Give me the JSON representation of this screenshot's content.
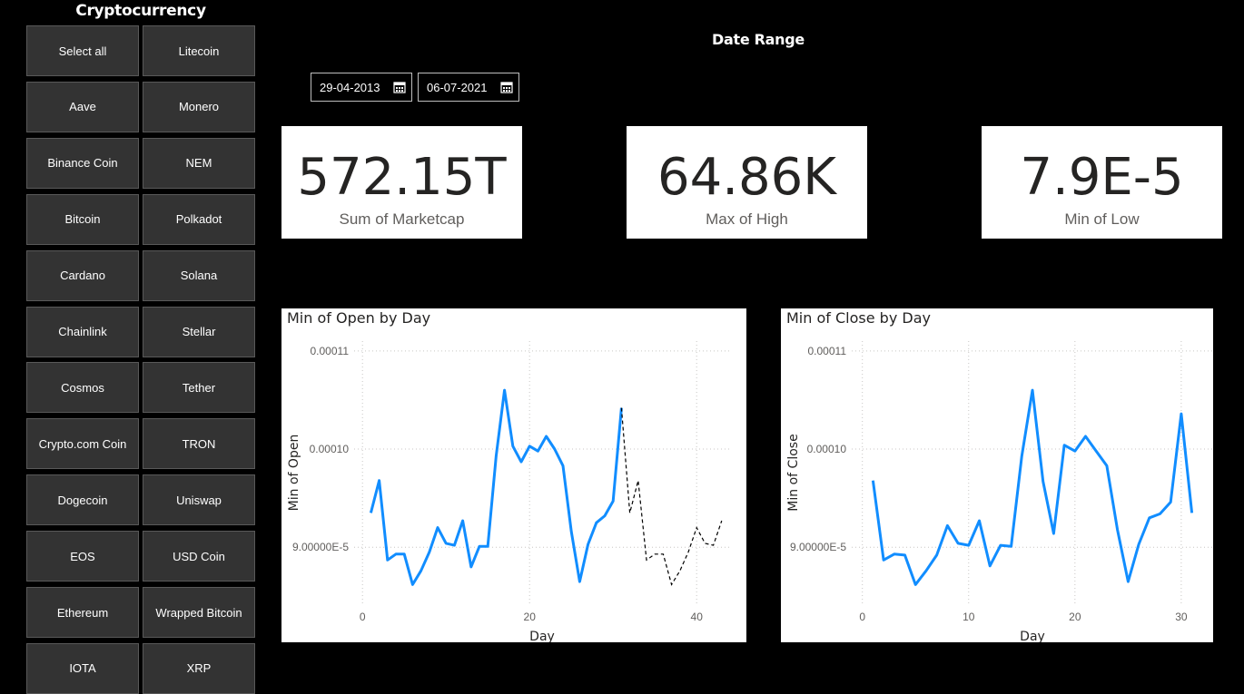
{
  "slicer": {
    "title": "Cryptocurrency",
    "items": [
      "Select all",
      "Litecoin",
      "Aave",
      "Monero",
      "Binance Coin",
      "NEM",
      "Bitcoin",
      "Polkadot",
      "Cardano",
      "Solana",
      "Chainlink",
      "Stellar",
      "Cosmos",
      "Tether",
      "Crypto.com Coin",
      "TRON",
      "Dogecoin",
      "Uniswap",
      "EOS",
      "USD Coin",
      "Ethereum",
      "Wrapped Bitcoin",
      "IOTA",
      "XRP"
    ]
  },
  "date_range": {
    "title": "Date Range",
    "start": "29-04-2013",
    "end": "06-07-2021",
    "icon": "calendar-icon"
  },
  "cards": [
    {
      "value": "572.15T",
      "label": "Sum of Marketcap"
    },
    {
      "value": "64.86K",
      "label": "Max of High"
    },
    {
      "value": "7.9E-5",
      "label": "Min of Low"
    }
  ],
  "colors": {
    "background": "#000000",
    "tile": "#333333",
    "line": "#118DFF",
    "forecast": "#000000"
  },
  "chart_data": [
    {
      "type": "line",
      "title": "Min of Open by Day",
      "xlabel": "Day",
      "ylabel": "Min of Open",
      "x_ticks": [
        0,
        20,
        40
      ],
      "y_ticks": [
        "9.00000E-5",
        "0.00010",
        "0.00011"
      ],
      "y_tick_values": [
        9e-05,
        0.0001,
        0.00011
      ],
      "xlim": [
        -1,
        44
      ],
      "ylim": [
        8.42e-05,
        0.000111
      ],
      "grid": true,
      "series": [
        {
          "style": "solid",
          "x": [
            1,
            2,
            3,
            4,
            5,
            6,
            7,
            8,
            9,
            10,
            11,
            12,
            13,
            14,
            15,
            16,
            17,
            18,
            19,
            20,
            21,
            22,
            23,
            24,
            25,
            26,
            27,
            28,
            29,
            30,
            31
          ],
          "y": [
            9.35e-05,
            9.68e-05,
            8.87e-05,
            8.93e-05,
            8.93e-05,
            8.62e-05,
            8.76e-05,
            8.95e-05,
            9.2e-05,
            9.04e-05,
            9.02e-05,
            9.27e-05,
            8.8e-05,
            9.01e-05,
            9.01e-05,
            9.93e-05,
            0.000106,
            0.0001003,
            9.87e-05,
            0.0001003,
            9.98e-05,
            0.0001013,
            0.0001,
            9.83e-05,
            9.16e-05,
            8.65e-05,
            9.03e-05,
            9.25e-05,
            9.32e-05,
            9.47e-05,
            0.0001042
          ]
        },
        {
          "style": "dashed",
          "x": [
            31,
            32,
            33,
            34,
            35,
            36,
            37,
            38,
            39,
            40,
            41,
            42,
            43
          ],
          "y": [
            0.0001042,
            9.35e-05,
            9.68e-05,
            8.87e-05,
            8.93e-05,
            8.93e-05,
            8.62e-05,
            8.76e-05,
            8.95e-05,
            9.2e-05,
            9.04e-05,
            9.02e-05,
            9.27e-05
          ]
        }
      ]
    },
    {
      "type": "line",
      "title": "Min of Close by Day",
      "xlabel": "Day",
      "ylabel": "Min of Close",
      "x_ticks": [
        0,
        10,
        20,
        30
      ],
      "y_ticks": [
        "9.00000E-5",
        "0.00010",
        "0.00011"
      ],
      "y_tick_values": [
        9e-05,
        0.0001,
        0.00011
      ],
      "xlim": [
        -1,
        33
      ],
      "ylim": [
        8.42e-05,
        0.000111
      ],
      "grid": true,
      "series": [
        {
          "style": "solid",
          "x": [
            1,
            2,
            3,
            4,
            5,
            6,
            7,
            8,
            9,
            10,
            11,
            12,
            13,
            14,
            15,
            16,
            17,
            18,
            19,
            20,
            21,
            22,
            23,
            24,
            25,
            26,
            27,
            28,
            29,
            30,
            31
          ],
          "y": [
            9.68e-05,
            8.87e-05,
            8.93e-05,
            8.92e-05,
            8.62e-05,
            8.76e-05,
            8.92e-05,
            9.22e-05,
            9.04e-05,
            9.02e-05,
            9.27e-05,
            8.81e-05,
            9.02e-05,
            9.01e-05,
            9.93e-05,
            0.000106,
            9.67e-05,
            9.14e-05,
            0.0001004,
            9.98e-05,
            0.0001013,
            9.98e-05,
            9.83e-05,
            9.18e-05,
            8.65e-05,
            9.03e-05,
            9.3e-05,
            9.34e-05,
            9.46e-05,
            0.0001036,
            9.35e-05
          ]
        }
      ]
    }
  ]
}
